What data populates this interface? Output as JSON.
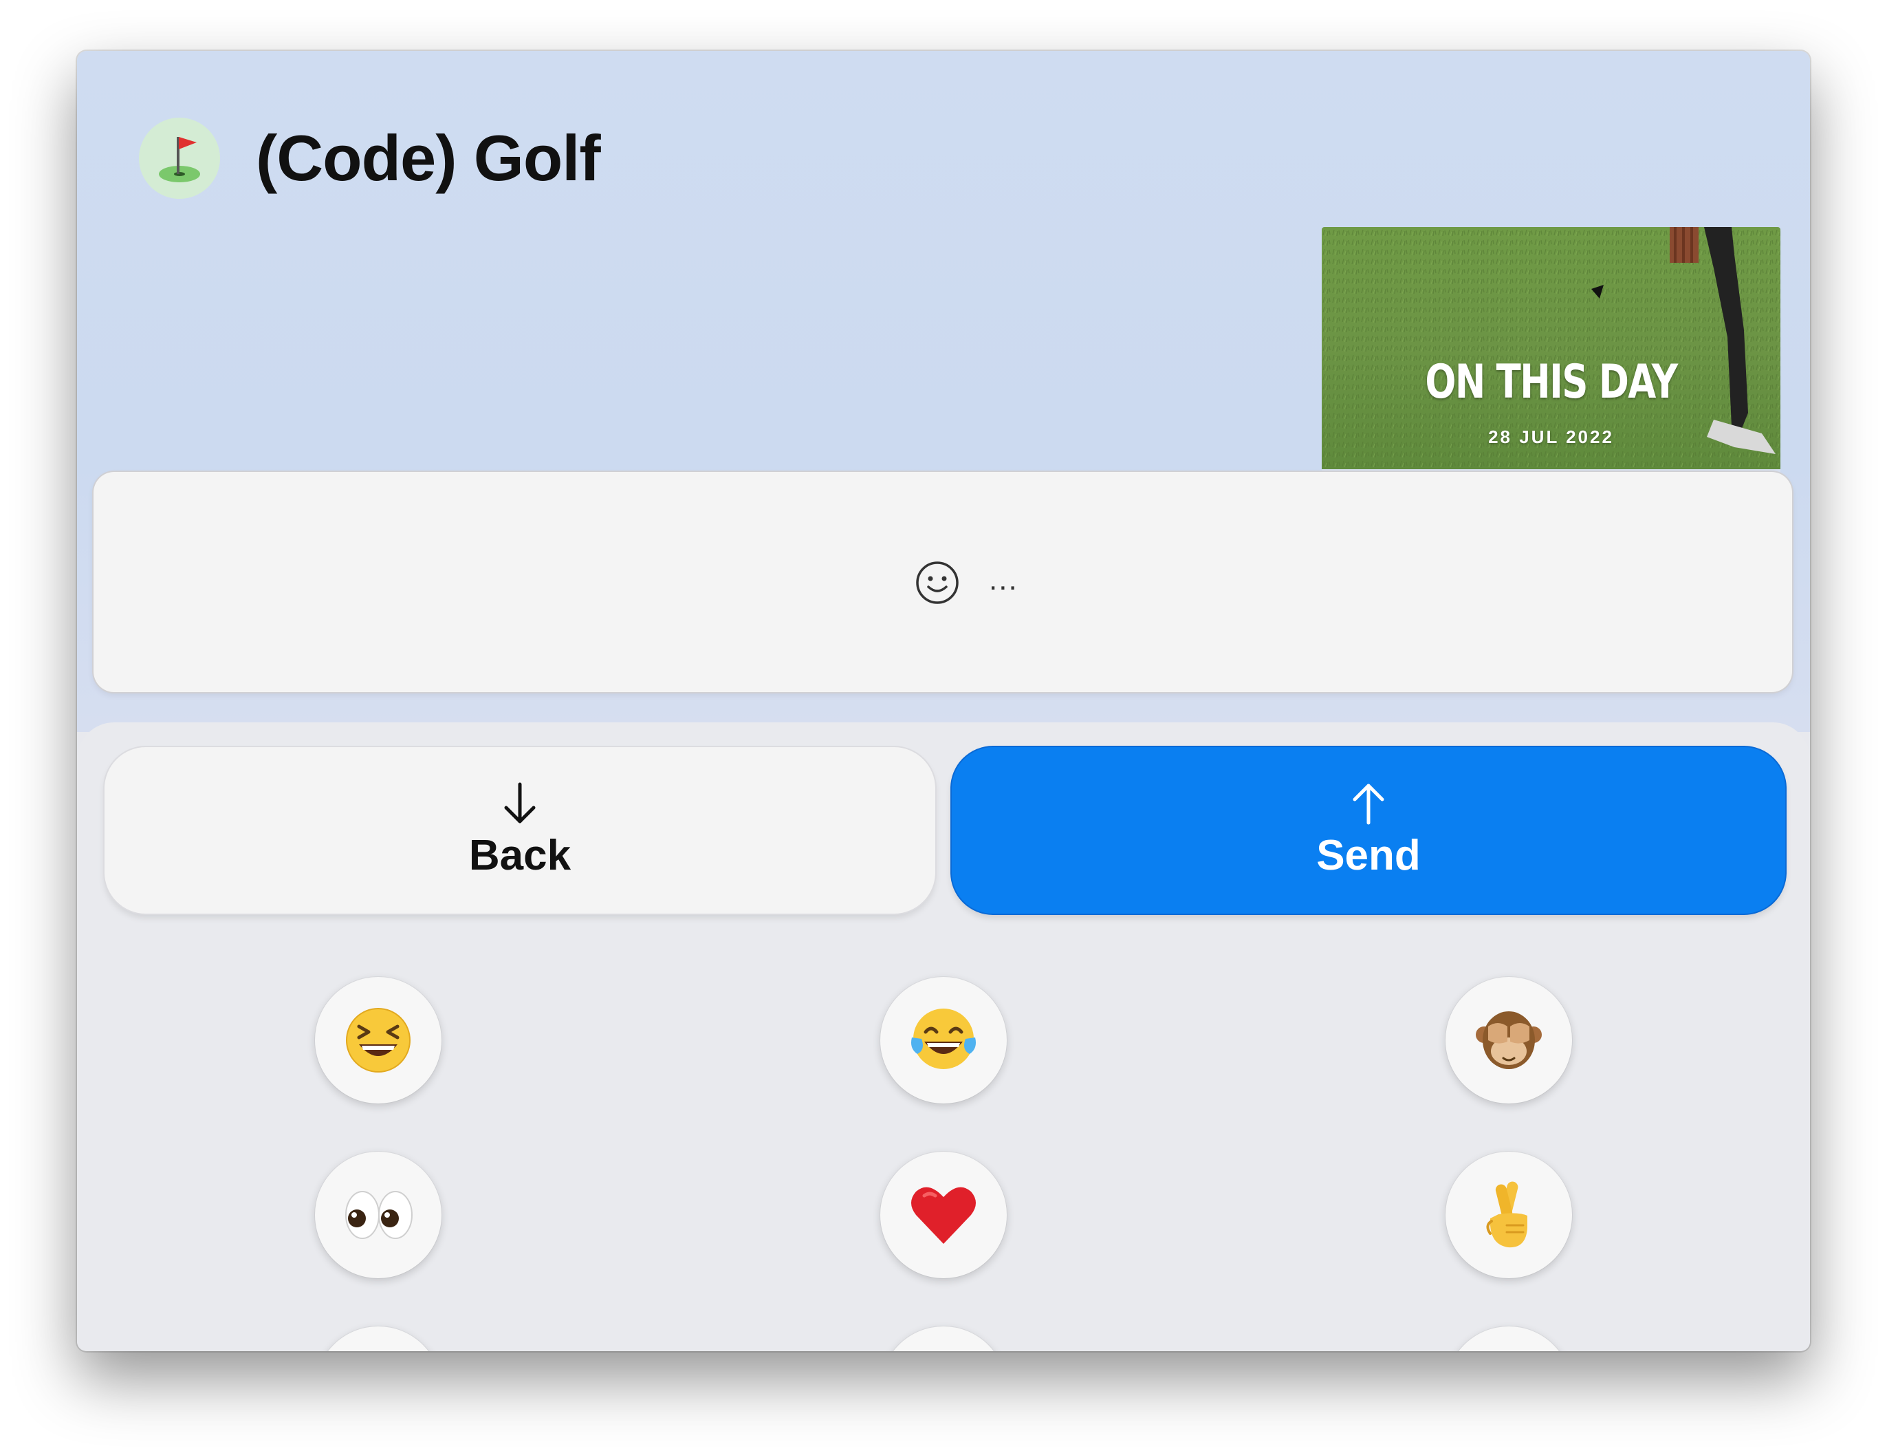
{
  "header": {
    "avatar_icon": "golf-flag-icon",
    "title": "(Code) Golf"
  },
  "media": {
    "title": "ON THIS DAY",
    "date": "28 JUL 2022"
  },
  "composer": {
    "emoji_icon": "smiley-icon",
    "placeholder": "..."
  },
  "actions": {
    "back_label": "Back",
    "send_label": "Send",
    "back_icon": "arrow-down-icon",
    "send_icon": "arrow-up-icon"
  },
  "emoji_grid": [
    {
      "name": "grinning-squinting-face-emoji-icon",
      "emoji": "😆"
    },
    {
      "name": "face-with-tears-of-joy-emoji-icon",
      "emoji": "😂"
    },
    {
      "name": "see-no-evil-monkey-emoji-icon",
      "emoji": "🙈"
    },
    {
      "name": "eyes-emoji-icon",
      "emoji": "👀"
    },
    {
      "name": "red-heart-emoji-icon",
      "emoji": "❤️"
    },
    {
      "name": "crossed-fingers-emoji-icon",
      "emoji": "🤞"
    }
  ],
  "colors": {
    "header_bg": "#cddaf0",
    "send_button": "#0a7ff1",
    "panel_bg": "#e9eaee"
  }
}
